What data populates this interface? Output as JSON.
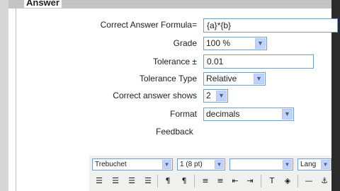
{
  "section": {
    "legend": "Answer"
  },
  "form": {
    "formula_label": "Correct Answer Formula=",
    "formula_value": "{a}*{b}",
    "grade_label": "Grade",
    "grade_value": "100 %",
    "tolerance_label": "Tolerance ±",
    "tolerance_value": "0.01",
    "tolerance_type_label": "Tolerance Type",
    "tolerance_type_value": "Relative",
    "shows_label": "Correct answer shows",
    "shows_value": "2",
    "format_label": "Format",
    "format_value": "decimals",
    "feedback_label": "Feedback"
  },
  "editor": {
    "font_family": "Trebuchet",
    "font_size": "1 (8 pt)",
    "style": "",
    "language": "Lang",
    "buttons": [
      {
        "name": "align-left-icon",
        "glyph": "☰"
      },
      {
        "name": "align-center-icon",
        "glyph": "☰"
      },
      {
        "name": "align-right-icon",
        "glyph": "☰"
      },
      {
        "name": "justify-icon",
        "glyph": "☰"
      },
      {
        "name": "ltr-icon",
        "glyph": "¶"
      },
      {
        "name": "rtl-icon",
        "glyph": "¶"
      },
      {
        "name": "ordered-list-icon",
        "glyph": "≡"
      },
      {
        "name": "unordered-list-icon",
        "glyph": "≡"
      },
      {
        "name": "outdent-icon",
        "glyph": "⇤"
      },
      {
        "name": "indent-icon",
        "glyph": "⇥"
      },
      {
        "name": "text-color-icon",
        "glyph": "T"
      },
      {
        "name": "background-color-icon",
        "glyph": "◈"
      },
      {
        "name": "horizontal-rule-icon",
        "glyph": "—"
      },
      {
        "name": "anchor-icon",
        "glyph": "⚓"
      }
    ]
  }
}
